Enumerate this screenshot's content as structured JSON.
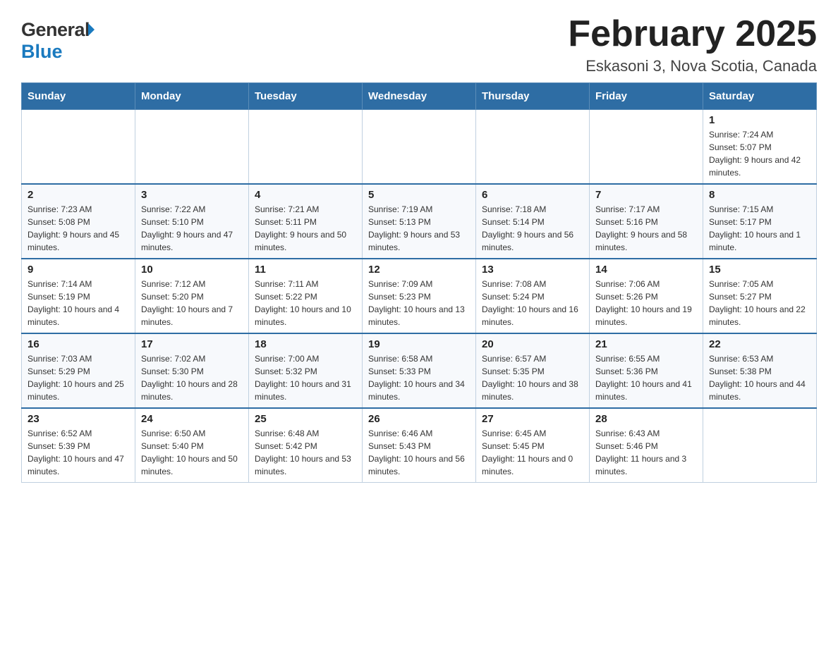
{
  "header": {
    "logo_general": "General",
    "logo_arrow": "▶",
    "logo_blue": "Blue",
    "title": "February 2025",
    "subtitle": "Eskasoni 3, Nova Scotia, Canada"
  },
  "calendar": {
    "days_of_week": [
      "Sunday",
      "Monday",
      "Tuesday",
      "Wednesday",
      "Thursday",
      "Friday",
      "Saturday"
    ],
    "weeks": [
      [
        {
          "day": "",
          "info": ""
        },
        {
          "day": "",
          "info": ""
        },
        {
          "day": "",
          "info": ""
        },
        {
          "day": "",
          "info": ""
        },
        {
          "day": "",
          "info": ""
        },
        {
          "day": "",
          "info": ""
        },
        {
          "day": "1",
          "info": "Sunrise: 7:24 AM\nSunset: 5:07 PM\nDaylight: 9 hours and 42 minutes."
        }
      ],
      [
        {
          "day": "2",
          "info": "Sunrise: 7:23 AM\nSunset: 5:08 PM\nDaylight: 9 hours and 45 minutes."
        },
        {
          "day": "3",
          "info": "Sunrise: 7:22 AM\nSunset: 5:10 PM\nDaylight: 9 hours and 47 minutes."
        },
        {
          "day": "4",
          "info": "Sunrise: 7:21 AM\nSunset: 5:11 PM\nDaylight: 9 hours and 50 minutes."
        },
        {
          "day": "5",
          "info": "Sunrise: 7:19 AM\nSunset: 5:13 PM\nDaylight: 9 hours and 53 minutes."
        },
        {
          "day": "6",
          "info": "Sunrise: 7:18 AM\nSunset: 5:14 PM\nDaylight: 9 hours and 56 minutes."
        },
        {
          "day": "7",
          "info": "Sunrise: 7:17 AM\nSunset: 5:16 PM\nDaylight: 9 hours and 58 minutes."
        },
        {
          "day": "8",
          "info": "Sunrise: 7:15 AM\nSunset: 5:17 PM\nDaylight: 10 hours and 1 minute."
        }
      ],
      [
        {
          "day": "9",
          "info": "Sunrise: 7:14 AM\nSunset: 5:19 PM\nDaylight: 10 hours and 4 minutes."
        },
        {
          "day": "10",
          "info": "Sunrise: 7:12 AM\nSunset: 5:20 PM\nDaylight: 10 hours and 7 minutes."
        },
        {
          "day": "11",
          "info": "Sunrise: 7:11 AM\nSunset: 5:22 PM\nDaylight: 10 hours and 10 minutes."
        },
        {
          "day": "12",
          "info": "Sunrise: 7:09 AM\nSunset: 5:23 PM\nDaylight: 10 hours and 13 minutes."
        },
        {
          "day": "13",
          "info": "Sunrise: 7:08 AM\nSunset: 5:24 PM\nDaylight: 10 hours and 16 minutes."
        },
        {
          "day": "14",
          "info": "Sunrise: 7:06 AM\nSunset: 5:26 PM\nDaylight: 10 hours and 19 minutes."
        },
        {
          "day": "15",
          "info": "Sunrise: 7:05 AM\nSunset: 5:27 PM\nDaylight: 10 hours and 22 minutes."
        }
      ],
      [
        {
          "day": "16",
          "info": "Sunrise: 7:03 AM\nSunset: 5:29 PM\nDaylight: 10 hours and 25 minutes."
        },
        {
          "day": "17",
          "info": "Sunrise: 7:02 AM\nSunset: 5:30 PM\nDaylight: 10 hours and 28 minutes."
        },
        {
          "day": "18",
          "info": "Sunrise: 7:00 AM\nSunset: 5:32 PM\nDaylight: 10 hours and 31 minutes."
        },
        {
          "day": "19",
          "info": "Sunrise: 6:58 AM\nSunset: 5:33 PM\nDaylight: 10 hours and 34 minutes."
        },
        {
          "day": "20",
          "info": "Sunrise: 6:57 AM\nSunset: 5:35 PM\nDaylight: 10 hours and 38 minutes."
        },
        {
          "day": "21",
          "info": "Sunrise: 6:55 AM\nSunset: 5:36 PM\nDaylight: 10 hours and 41 minutes."
        },
        {
          "day": "22",
          "info": "Sunrise: 6:53 AM\nSunset: 5:38 PM\nDaylight: 10 hours and 44 minutes."
        }
      ],
      [
        {
          "day": "23",
          "info": "Sunrise: 6:52 AM\nSunset: 5:39 PM\nDaylight: 10 hours and 47 minutes."
        },
        {
          "day": "24",
          "info": "Sunrise: 6:50 AM\nSunset: 5:40 PM\nDaylight: 10 hours and 50 minutes."
        },
        {
          "day": "25",
          "info": "Sunrise: 6:48 AM\nSunset: 5:42 PM\nDaylight: 10 hours and 53 minutes."
        },
        {
          "day": "26",
          "info": "Sunrise: 6:46 AM\nSunset: 5:43 PM\nDaylight: 10 hours and 56 minutes."
        },
        {
          "day": "27",
          "info": "Sunrise: 6:45 AM\nSunset: 5:45 PM\nDaylight: 11 hours and 0 minutes."
        },
        {
          "day": "28",
          "info": "Sunrise: 6:43 AM\nSunset: 5:46 PM\nDaylight: 11 hours and 3 minutes."
        },
        {
          "day": "",
          "info": ""
        }
      ]
    ]
  }
}
